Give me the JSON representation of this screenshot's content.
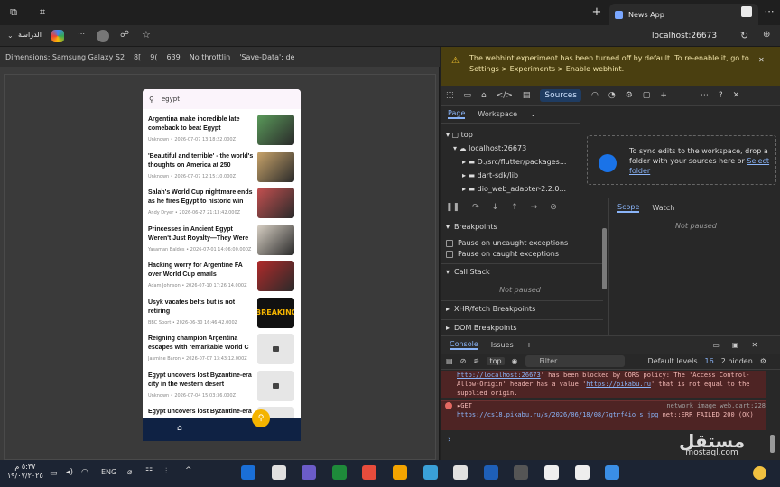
{
  "browser": {
    "tab_title": "News App",
    "profile_label": "الدراسة",
    "address": "localhost:26673",
    "device_toolbar": {
      "dimensions_label": "Dimensions: Samsung Galaxy S2",
      "width": "8[",
      "height": "9(",
      "zoom": "639",
      "throttle": "No throttlin",
      "save_data": "'Save-Data': de"
    }
  },
  "app": {
    "search_text": "egypt",
    "articles": [
      {
        "title": "Argentina make incredible late comeback to beat Egypt",
        "meta": "Unknown • 2026-07-07 13:18:22.000Z",
        "thumb": "photo"
      },
      {
        "title": "'Beautiful and terrible' - the world's thoughts on America at 250",
        "meta": "Unknown • 2026-07-07 12:15:10.000Z",
        "thumb": "photo"
      },
      {
        "title": "Salah's World Cup nightmare ends as he fires Egypt to historic win",
        "meta": "Andy Dryer • 2026-06-27 21:13:42.000Z",
        "thumb": "photo"
      },
      {
        "title": "Princesses in Ancient Egypt Weren't Just Royalty—They Were ...",
        "meta": "Yasaman Baldes • 2026-07-01 14:06:00.000Z",
        "thumb": "photo"
      },
      {
        "title": "Hacking worry for Argentine FA over World Cup emails",
        "meta": "Adam Johnson • 2026-07-10 17:26:14.000Z",
        "thumb": "photo"
      },
      {
        "title": "Usyk vacates belts but is not retiring",
        "meta": "BBC Sport • 2026-06-30 16:46:42.000Z",
        "thumb": "BREAKING"
      },
      {
        "title": "Reigning champion Argentina escapes with remarkable World C",
        "meta": "Jasmine Baron • 2026-07-07 13:43:12.000Z",
        "thumb": "placeholder"
      },
      {
        "title": "Egypt uncovers lost Byzantine-era city in the western desert",
        "meta": "Unknown • 2026-07-04 15:03:36.000Z",
        "thumb": "placeholder"
      },
      {
        "title": "Egypt uncovers lost Byzantine-era",
        "meta": "",
        "thumb": "placeholder"
      }
    ]
  },
  "devtools": {
    "banner": "The webhint experiment has been turned off by default. To re-enable it, go to Settings > Experiments > Enable webhint.",
    "tabs": [
      "Sources"
    ],
    "page_tab": "Page",
    "workspace_tab": "Workspace",
    "tree": [
      "top",
      "localhost:26673",
      "D:/src/flutter/packages...",
      "dart-sdk/lib",
      "dio_web_adapter-2.2.0..."
    ],
    "sync_text": "To sync edits to the workspace, drop a folder with your sources here or",
    "sync_link": "Select folder",
    "breakpoints": "Breakpoints",
    "pause_uncaught": "Pause on uncaught exceptions",
    "pause_caught": "Pause on caught exceptions",
    "call_stack": "Call Stack",
    "not_paused": "Not paused",
    "xhr": "XHR/fetch Breakpoints",
    "dom": "DOM Breakpoints",
    "scope": "Scope",
    "watch": "Watch",
    "console_tab": "Console",
    "issues_tab": "Issues",
    "context": "top",
    "filter_placeholder": "Filter",
    "levels": "Default levels",
    "issues_count": "16",
    "hidden": "2 hidden",
    "errors": [
      {
        "a_link": "http://localhost:26673",
        "a_text": "' has been blocked by CORS policy: The 'Access Control-Allow-Origin' header has a value '",
        "a_link2": "https://pikabu.ru",
        "a_tail": "' that is not equal to the supplied origin."
      },
      {
        "b_source": "network_image_web.dart:228",
        "b_prefix": "GET",
        "b_link": "https://cs18.pikabu.ru/s/2026/06/18/08/7gtrf4io_s.jpg",
        "b_text": "net::ERR_FAILED 200 (OK)"
      }
    ]
  },
  "taskbar": {
    "time": "٥:٣٧ م",
    "date": "١٩/٠٧/٢٠٢٥",
    "lang": "ENG"
  },
  "watermark": {
    "ar": "مستقل",
    "en": "mostaql.com"
  },
  "colors": {
    "accent": "#f4b400",
    "navy": "#0f2244",
    "banner": "#4a3f10"
  }
}
